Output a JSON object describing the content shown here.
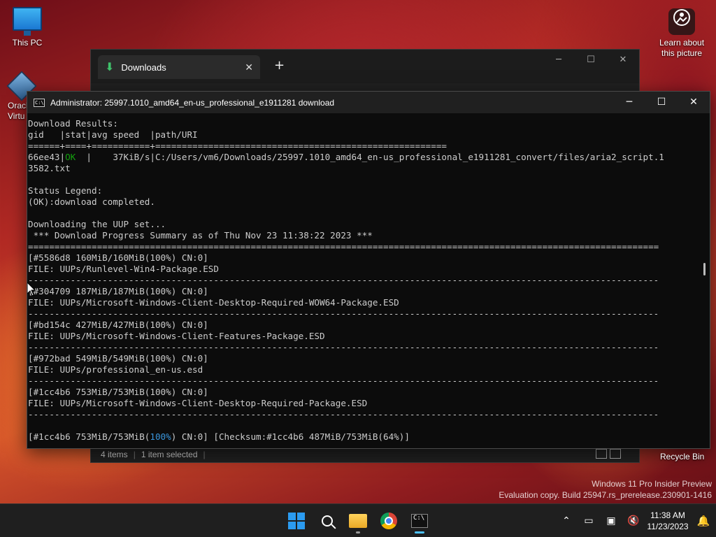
{
  "desktop": {
    "icons": [
      {
        "label": "This PC"
      },
      {
        "label": "Oracl\nVirtu"
      }
    ],
    "learn": {
      "label": "Learn about\nthis picture"
    },
    "recycle_bin": "Recycle Bin",
    "watermark": {
      "line1": "Windows 11 Pro Insider Preview",
      "line2": "Evaluation copy. Build 25947.rs_prerelease.230901-1416"
    }
  },
  "explorer": {
    "tab_label": "Downloads",
    "status_items": "4 items",
    "status_selected": "1 item selected"
  },
  "console": {
    "title": "Administrator:  25997.1010_amd64_en-us_professional_e1911281 download",
    "lines": [
      "Download Results:",
      "gid   |stat|avg speed  |path/URI",
      "======+====+===========+=======================================================",
      "__OKROW__",
      "3582.txt",
      "",
      "Status Legend:",
      "(OK):download completed.",
      "",
      "Downloading the UUP set...",
      " *** Download Progress Summary as of Thu Nov 23 11:38:22 2023 ***",
      "=======================================================================================================================",
      "[#5586d8 160MiB/160MiB(100%) CN:0]",
      "FILE: UUPs/Runlevel-Win4-Package.ESD",
      "-----------------------------------------------------------------------------------------------------------------------",
      "[#304709 187MiB/187MiB(100%) CN:0]",
      "FILE: UUPs/Microsoft-Windows-Client-Desktop-Required-WOW64-Package.ESD",
      "-----------------------------------------------------------------------------------------------------------------------",
      "[#bd154c 427MiB/427MiB(100%) CN:0]",
      "FILE: UUPs/Microsoft-Windows-Client-Features-Package.ESD",
      "-----------------------------------------------------------------------------------------------------------------------",
      "[#972bad 549MiB/549MiB(100%) CN:0]",
      "FILE: UUPs/professional_en-us.esd",
      "-----------------------------------------------------------------------------------------------------------------------",
      "[#1cc4b6 753MiB/753MiB(100%) CN:0]",
      "FILE: UUPs/Microsoft-Windows-Client-Desktop-Required-Package.ESD",
      "-----------------------------------------------------------------------------------------------------------------------",
      "",
      "__LASTROW__"
    ],
    "ok_row": {
      "gid": "66ee43|",
      "stat": "OK",
      "rest": "  |    37KiB/s|C:/Users/vm6/Downloads/25997.1010_amd64_en-us_professional_e1911281_convert/files/aria2_script.1"
    },
    "last_row": {
      "prefix": "[#1cc4b6 753MiB/753MiB(",
      "pct": "100%",
      "suffix": ") CN:0] [Checksum:#1cc4b6 487MiB/753MiB(64%)]"
    }
  },
  "taskbar": {
    "time": "11:38 AM",
    "date": "11/23/2023"
  }
}
